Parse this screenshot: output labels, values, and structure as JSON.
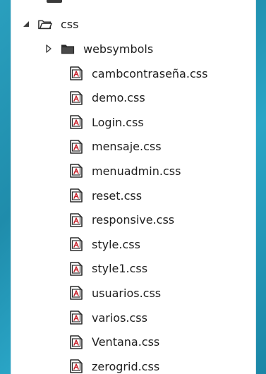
{
  "tree": {
    "root_folder": {
      "label": "css",
      "expanded": true,
      "icon": "folder-open-icon"
    },
    "subfolder": {
      "label": "websymbols",
      "expanded": false,
      "icon": "folder-icon"
    },
    "files": [
      {
        "label": "cambcontraseña.css",
        "icon": "css-file-icon"
      },
      {
        "label": "demo.css",
        "icon": "css-file-icon"
      },
      {
        "label": "Login.css",
        "icon": "css-file-icon"
      },
      {
        "label": "mensaje.css",
        "icon": "css-file-icon"
      },
      {
        "label": "menuadmin.css",
        "icon": "css-file-icon"
      },
      {
        "label": "reset.css",
        "icon": "css-file-icon"
      },
      {
        "label": "responsive.css",
        "icon": "css-file-icon"
      },
      {
        "label": "style.css",
        "icon": "css-file-icon"
      },
      {
        "label": "style1.css",
        "icon": "css-file-icon"
      },
      {
        "label": "usuarios.css",
        "icon": "css-file-icon"
      },
      {
        "label": "varios.css",
        "icon": "css-file-icon"
      },
      {
        "label": "Ventana.css",
        "icon": "css-file-icon"
      },
      {
        "label": "zerogrid.css",
        "icon": "css-file-icon"
      }
    ]
  },
  "colors": {
    "background": "#2196b8",
    "panel": "#ffffff",
    "text": "#1e1e1e",
    "css_icon_accent": "#c8202a"
  }
}
